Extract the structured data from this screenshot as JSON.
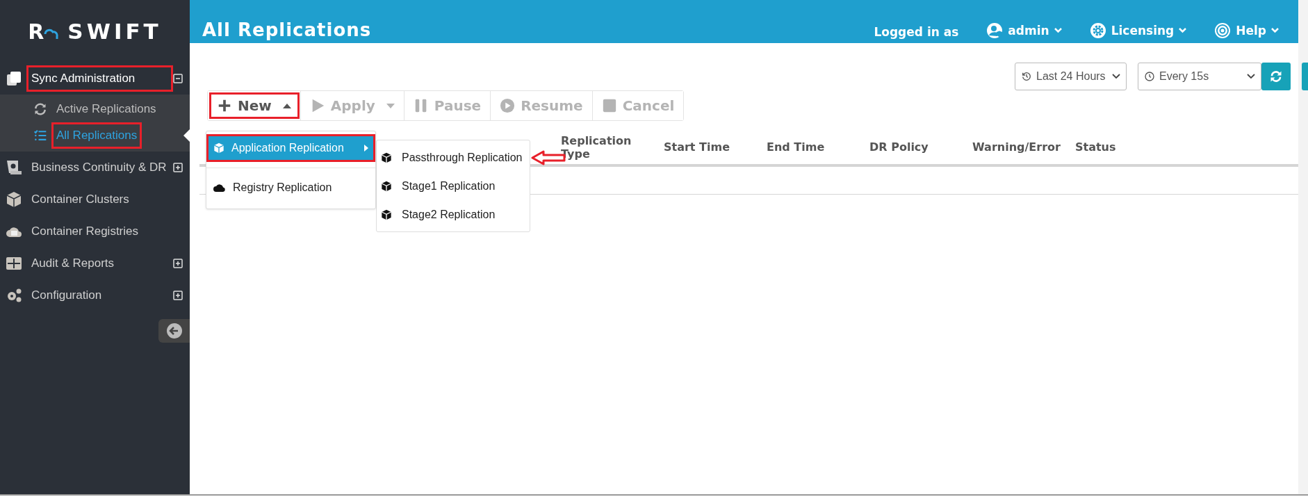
{
  "brand": {
    "letter": "R",
    "name": "SWIFT"
  },
  "sidebar": {
    "items": [
      {
        "label": "Sync Administration",
        "expandable": true,
        "expanded": true,
        "highlighted": true,
        "children": [
          {
            "label": "Active Replications",
            "selected": false,
            "highlighted": false
          },
          {
            "label": "All Replications",
            "selected": true,
            "highlighted": true
          }
        ]
      },
      {
        "label": "Business Continuity & DR",
        "expandable": true,
        "expanded": false,
        "highlighted": false
      },
      {
        "label": "Container Clusters",
        "expandable": false,
        "expanded": false,
        "highlighted": false
      },
      {
        "label": "Container Registries",
        "expandable": false,
        "expanded": false,
        "highlighted": false
      },
      {
        "label": "Audit & Reports",
        "expandable": true,
        "expanded": false,
        "highlighted": false
      },
      {
        "label": "Configuration",
        "expandable": true,
        "expanded": false,
        "highlighted": false
      }
    ]
  },
  "header": {
    "title": "All Replications",
    "logged_in_label": "Logged in as",
    "menus": [
      {
        "label": "admin"
      },
      {
        "label": "Licensing"
      },
      {
        "label": "Help"
      }
    ]
  },
  "filters": [
    {
      "value": "Last 24 Hours"
    },
    {
      "value": "Every 15s"
    }
  ],
  "toolbar": [
    {
      "label": "New",
      "dropdown": true,
      "open": true,
      "disabled": false,
      "highlighted": true
    },
    {
      "label": "Apply",
      "dropdown": true,
      "open": false,
      "disabled": true,
      "highlighted": false
    },
    {
      "label": "Pause",
      "disabled": true,
      "highlighted": false
    },
    {
      "label": "Resume",
      "disabled": true,
      "highlighted": false
    },
    {
      "label": "Cancel",
      "disabled": true,
      "highlighted": false
    }
  ],
  "new_menu": [
    {
      "label": "Application Replication",
      "selected": true,
      "highlighted": true,
      "submenu": [
        {
          "label": "Passthrough Replication",
          "pointed": true
        },
        {
          "label": "Stage1 Replication",
          "pointed": false
        },
        {
          "label": "Stage2 Replication",
          "pointed": false
        }
      ]
    },
    {
      "label": "Registry Replication",
      "selected": false,
      "highlighted": false
    }
  ],
  "table": {
    "columns": [
      "Replication Type",
      "Start Time",
      "End Time",
      "DR Policy",
      "Warning/Error",
      "Status"
    ]
  }
}
